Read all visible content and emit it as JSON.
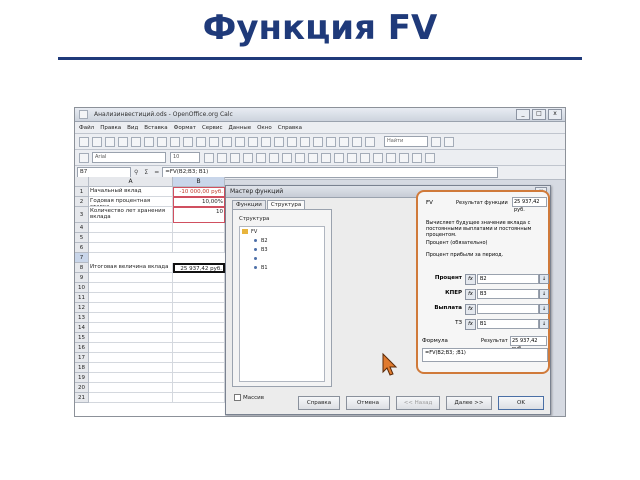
{
  "slide": {
    "title": "Функция FV"
  },
  "window": {
    "title": "Анализинвестиций.ods - OpenOffice.org Calc",
    "controls": [
      "_",
      "□",
      "x"
    ],
    "menu": [
      "Файл",
      "Правка",
      "Вид",
      "Вставка",
      "Формат",
      "Сервис",
      "Данные",
      "Окно",
      "Справка"
    ],
    "search_placeholder": "Найти",
    "font_name": "Arial",
    "font_size": "10",
    "name_box": "B7",
    "formula": "=FV(B2;B3; B1)"
  },
  "sheet": {
    "columns": [
      "A",
      "B"
    ],
    "rows": [
      "1",
      "2",
      "3",
      "4",
      "5",
      "6",
      "7",
      "8",
      "9",
      "10",
      "11",
      "12",
      "13",
      "14",
      "15",
      "16",
      "17",
      "18",
      "19",
      "20",
      "21"
    ],
    "cells": {
      "a1": "Начальный вклад",
      "a2": "Годовая процентная ставка",
      "a3": "Количество лет хранения вклада",
      "a7": "Итоговая величина вклада",
      "b1": "-10 000,00 руб.",
      "b2": "10,00%",
      "b3": "10",
      "b7": "25 937,42 руб."
    }
  },
  "dialog": {
    "title": "Мастер функций",
    "close": "x",
    "tabs": [
      "Функции",
      "Структура"
    ],
    "structure_label": "Структура",
    "tree_root": "FV",
    "tree_nodes": [
      "B2",
      "B3",
      "",
      "B1"
    ],
    "nested_label": "Массив",
    "function_name": "FV",
    "result_label": "Результат функции",
    "result_value": "25 937,42 руб.",
    "description": "Вычисляет будущее значение вклада с постоянными выплатами и постоянным процентом.",
    "param_heading": "Процент (обязательно)",
    "param_desc": "Процент прибыли за период.",
    "args": [
      {
        "label": "Процент",
        "value": "B2"
      },
      {
        "label": "КПЕР",
        "value": "B3"
      },
      {
        "label": "Выплата",
        "value": ""
      },
      {
        "label": "ТЗ",
        "value": "B1"
      }
    ],
    "fx": "fx",
    "result2_label": "Результат",
    "result2_value": "25 937,42 руб.",
    "formula_label": "Формула",
    "formula_value": "=FV(B2;B3; ;B1)",
    "buttons": {
      "help": "Справка",
      "cancel": "Отмена",
      "back": "<< Назад",
      "next": "Далее >>",
      "ok": "OK"
    }
  }
}
